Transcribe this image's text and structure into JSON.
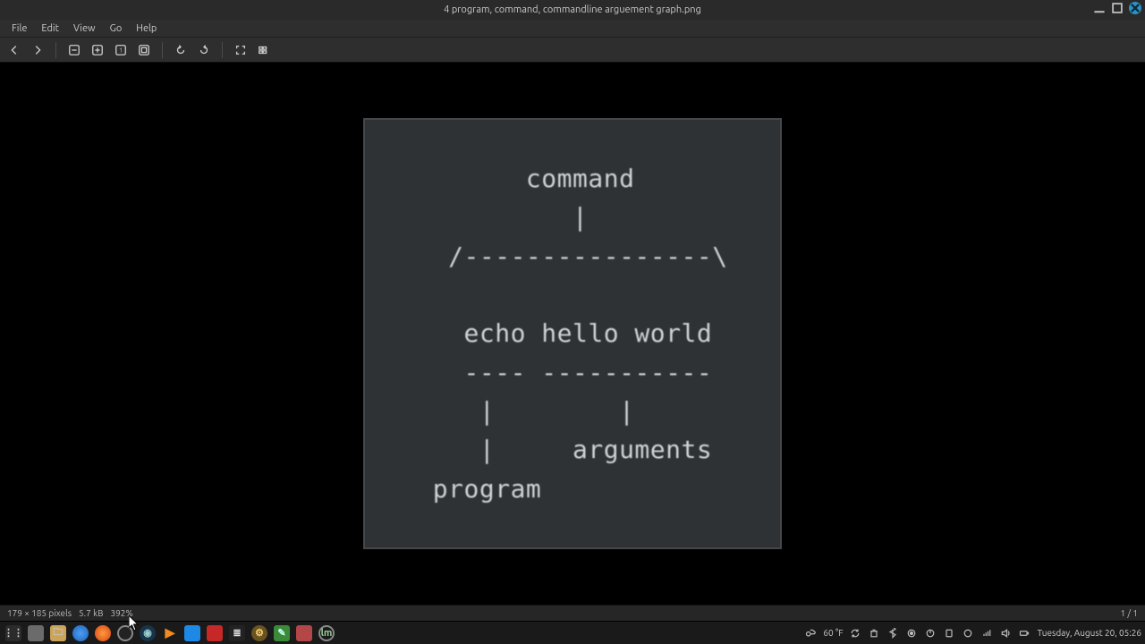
{
  "titlebar": {
    "title": "4 program, command, commandline arguement graph.png"
  },
  "menu": {
    "file": "File",
    "edit": "Edit",
    "view": "View",
    "go": "Go",
    "help": "Help"
  },
  "toolbar": {
    "back": "back",
    "forward": "forward",
    "zoom_out": "zoom-out",
    "zoom_in": "zoom-in",
    "zoom_original": "zoom-original",
    "zoom_fit": "zoom-fit",
    "rotate_left": "rotate-left",
    "rotate_right": "rotate-right",
    "fullscreen": "fullscreen",
    "slideshow": "slideshow"
  },
  "image_content": {
    "lines": [
      "       command",
      "          |",
      "  /----------------\\",
      "",
      "   echo hello world",
      "   ---- -----------",
      "    |        |",
      "    |     arguments",
      " program"
    ]
  },
  "status": {
    "dimensions": "179 × 185 pixels",
    "filesize": "5.7 kB",
    "zoom": "392%",
    "page": "1 / 1"
  },
  "panel": {
    "weather": "60 °F",
    "clock": "Tuesday, August 20, 05:26"
  }
}
